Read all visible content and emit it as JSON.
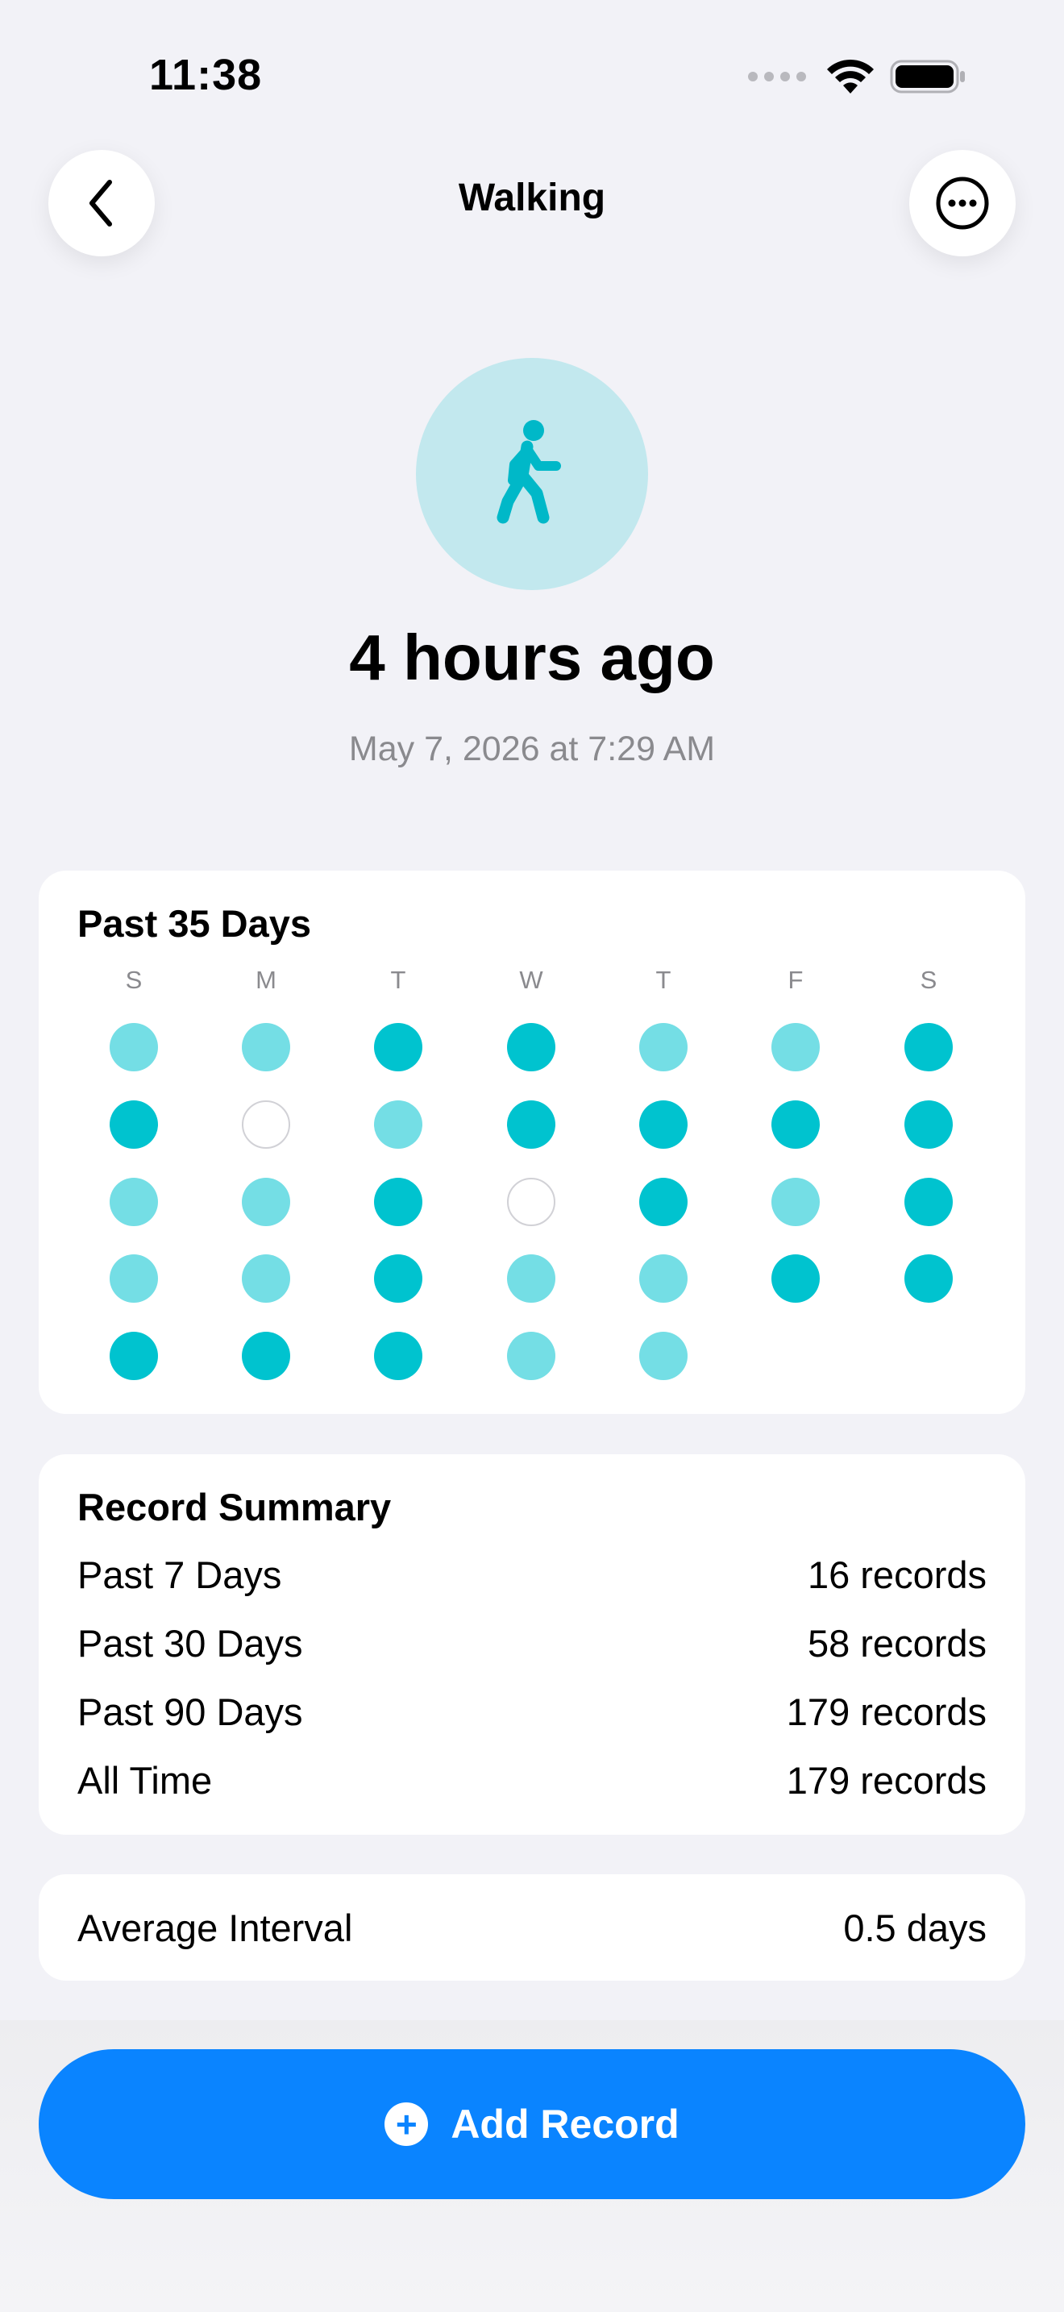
{
  "status": {
    "time": "11:38"
  },
  "nav": {
    "title": "Walking"
  },
  "hero": {
    "relative": "4 hours ago",
    "datetime": "May 7, 2026 at 7:29 AM"
  },
  "calendar": {
    "title": "Past 35 Days",
    "weekdays": [
      "S",
      "M",
      "T",
      "W",
      "T",
      "F",
      "S"
    ],
    "levels": [
      [
        "low",
        "low",
        "high",
        "high",
        "low",
        "low",
        "high"
      ],
      [
        "high",
        "none",
        "low",
        "high",
        "high",
        "high",
        "high"
      ],
      [
        "low",
        "low",
        "high",
        "none",
        "high",
        "low",
        "high"
      ],
      [
        "low",
        "low",
        "high",
        "low",
        "low",
        "high",
        "high"
      ],
      [
        "high",
        "high",
        "high",
        "low",
        "low"
      ]
    ]
  },
  "summary": {
    "title": "Record Summary",
    "rows": [
      {
        "label": "Past 7 Days",
        "value": "16 records"
      },
      {
        "label": "Past 30 Days",
        "value": "58 records"
      },
      {
        "label": "Past 90 Days",
        "value": "179 records"
      },
      {
        "label": "All Time",
        "value": "179 records"
      }
    ]
  },
  "interval": {
    "label": "Average Interval",
    "value": "0.5 days"
  },
  "add_button": {
    "label": "Add Record",
    "icon": "plus-circle-icon"
  },
  "colors": {
    "accent": "#0A84FF",
    "activity_high": "#00C3CF",
    "activity_low": "#74DEE5",
    "hero_bg": "#C2E8EE"
  }
}
